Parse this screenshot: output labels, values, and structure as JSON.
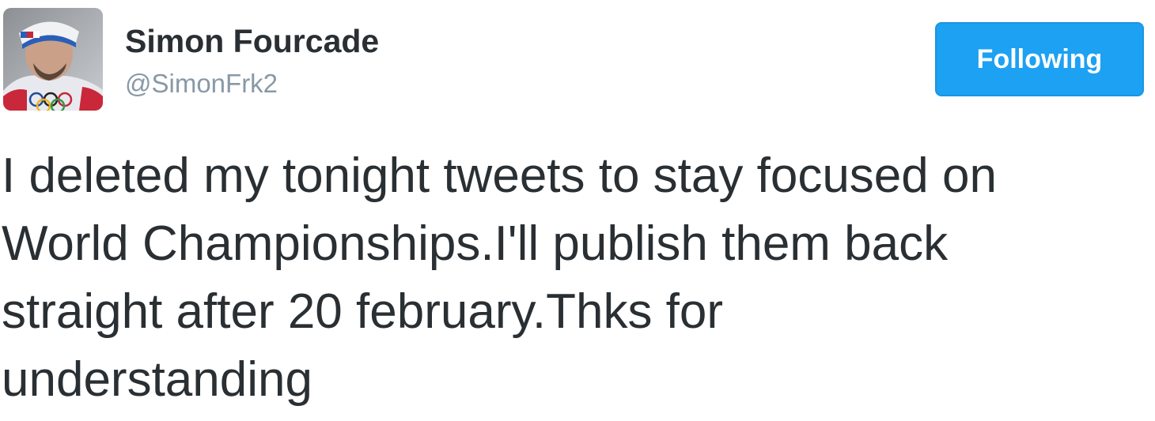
{
  "author": {
    "display_name": "Simon Fourcade",
    "handle": "@SimonFrk2",
    "avatar_icon": "profile-photo"
  },
  "follow_button": {
    "label": "Following",
    "color": "#1da1f2"
  },
  "tweet": {
    "text": "I deleted my tonight tweets to stay focused on\nWorld Championships.I'll publish them back\nstraight after 20 february.Thks for\nunderstanding"
  },
  "colors": {
    "text": "#292f33",
    "handle": "#8899a6"
  }
}
